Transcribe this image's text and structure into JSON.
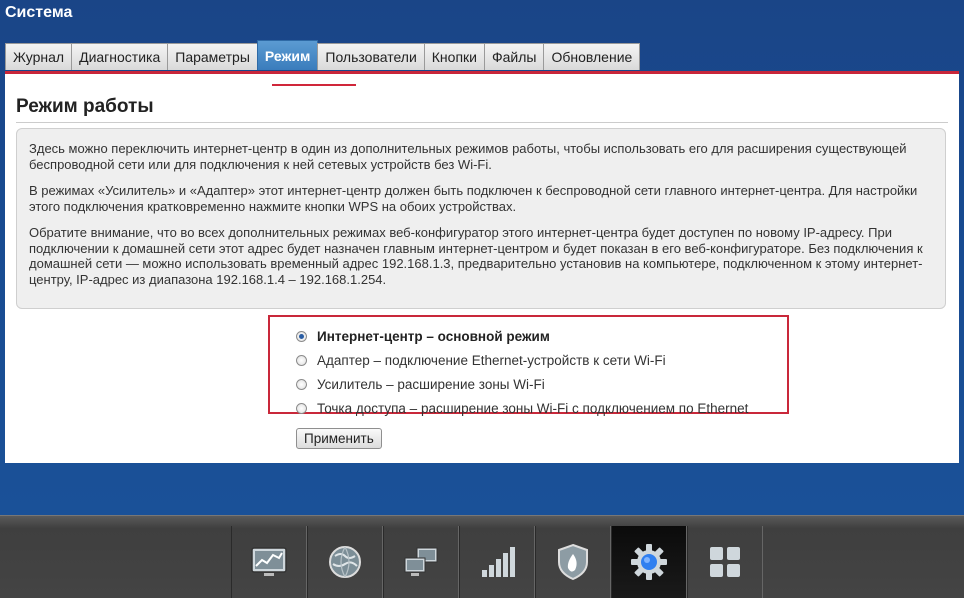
{
  "app": {
    "title": "Система"
  },
  "tabs": [
    {
      "label": "Журнал",
      "active": false
    },
    {
      "label": "Диагностика",
      "active": false
    },
    {
      "label": "Параметры",
      "active": false
    },
    {
      "label": "Режим",
      "active": true
    },
    {
      "label": "Пользователи",
      "active": false
    },
    {
      "label": "Кнопки",
      "active": false
    },
    {
      "label": "Файлы",
      "active": false
    },
    {
      "label": "Обновление",
      "active": false
    }
  ],
  "section": {
    "title": "Режим работы",
    "info": [
      "Здесь можно переключить интернет-центр в один из дополнительных режимов работы, чтобы использовать его для расширения существующей беспроводной сети или для подключения к ней сетевых устройств без Wi-Fi.",
      "В режимах «Усилитель» и «Адаптер» этот интернет-центр должен быть подключен к беспроводной сети главного интернет-центра. Для настройки этого подключения кратковременно нажмите кнопки WPS на обоих устройствах.",
      "Обратите внимание, что во всех дополнительных режимах веб-конфигуратор этого интернет-центра будет доступен по новому IP-адресу. При подключении к домашней сети этот адрес будет назначен главным интернет-центром и будет показан в его веб-конфигураторе. Без подключения к домашней сети — можно использовать временный адрес 192.168.1.3, предварительно установив на компьютере, подключенном к этому интернет-центру, IP-адрес из диапазона 192.168.1.4 – 192.168.1.254."
    ]
  },
  "modes": {
    "options": [
      {
        "label": "Интернет-центр – основной режим",
        "selected": true
      },
      {
        "label": "Адаптер – подключение Ethernet-устройств к сети Wi-Fi",
        "selected": false
      },
      {
        "label": "Усилитель – расширение зоны Wi-Fi",
        "selected": false
      },
      {
        "label": "Точка доступа – расширение зоны Wi-Fi с подключением по Ethernet",
        "selected": false
      }
    ],
    "apply_label": "Применить"
  },
  "dock": {
    "items": [
      {
        "icon": "monitor-chart-icon",
        "active": false
      },
      {
        "icon": "globe-icon",
        "active": false
      },
      {
        "icon": "network-computers-icon",
        "active": false
      },
      {
        "icon": "signal-bars-icon",
        "active": false
      },
      {
        "icon": "shield-icon",
        "active": false
      },
      {
        "icon": "gear-icon",
        "active": true
      },
      {
        "icon": "apps-grid-icon",
        "active": false
      }
    ]
  },
  "colors": {
    "accent_red": "#c8263a",
    "tab_active": "#3a7cbc",
    "background_blue": "#1a4587"
  }
}
